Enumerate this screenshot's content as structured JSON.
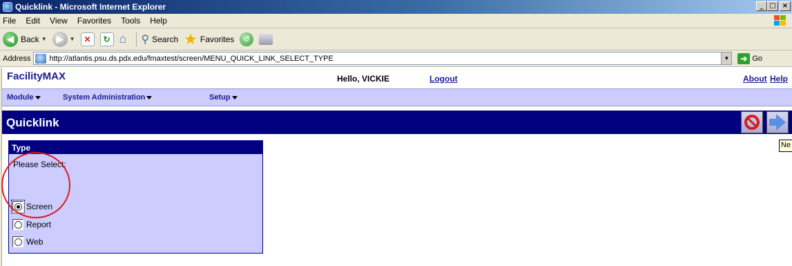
{
  "window": {
    "title": "Quicklink - Microsoft Internet Explorer",
    "min_glyph": "_",
    "max_glyph": "□",
    "close_glyph": "×"
  },
  "menu": {
    "items": [
      {
        "label": "File"
      },
      {
        "label": "Edit"
      },
      {
        "label": "View"
      },
      {
        "label": "Favorites"
      },
      {
        "label": "Tools"
      },
      {
        "label": "Help"
      }
    ]
  },
  "toolbar": {
    "back_label": "Back",
    "search_label": "Search",
    "favorites_label": "Favorites"
  },
  "address": {
    "label": "Address",
    "url": "http://atlantis.psu.ds.pdx.edu/fmaxtest/screen/MENU_QUICK_LINK_SELECT_TYPE",
    "go_label": "Go"
  },
  "app": {
    "brand": "FacilityMAX",
    "greeting": "Hello, VICKIE",
    "logout": "Logout",
    "about": "About",
    "help": "Help"
  },
  "nav": {
    "items": [
      {
        "label": "Module"
      },
      {
        "label": "System Administration"
      },
      {
        "label": "Setup"
      }
    ]
  },
  "quicklink": {
    "title": "Quicklink",
    "tooltip": "Ne"
  },
  "type_panel": {
    "title": "Type",
    "prompt": "Please Select:",
    "options": [
      {
        "label": "Screen",
        "selected": true
      },
      {
        "label": "Report",
        "selected": false
      },
      {
        "label": "Web",
        "selected": false
      }
    ]
  },
  "colors": {
    "app_blue": "#000080",
    "nav_lavender": "#ccccff",
    "annotation_red": "#e01818"
  }
}
